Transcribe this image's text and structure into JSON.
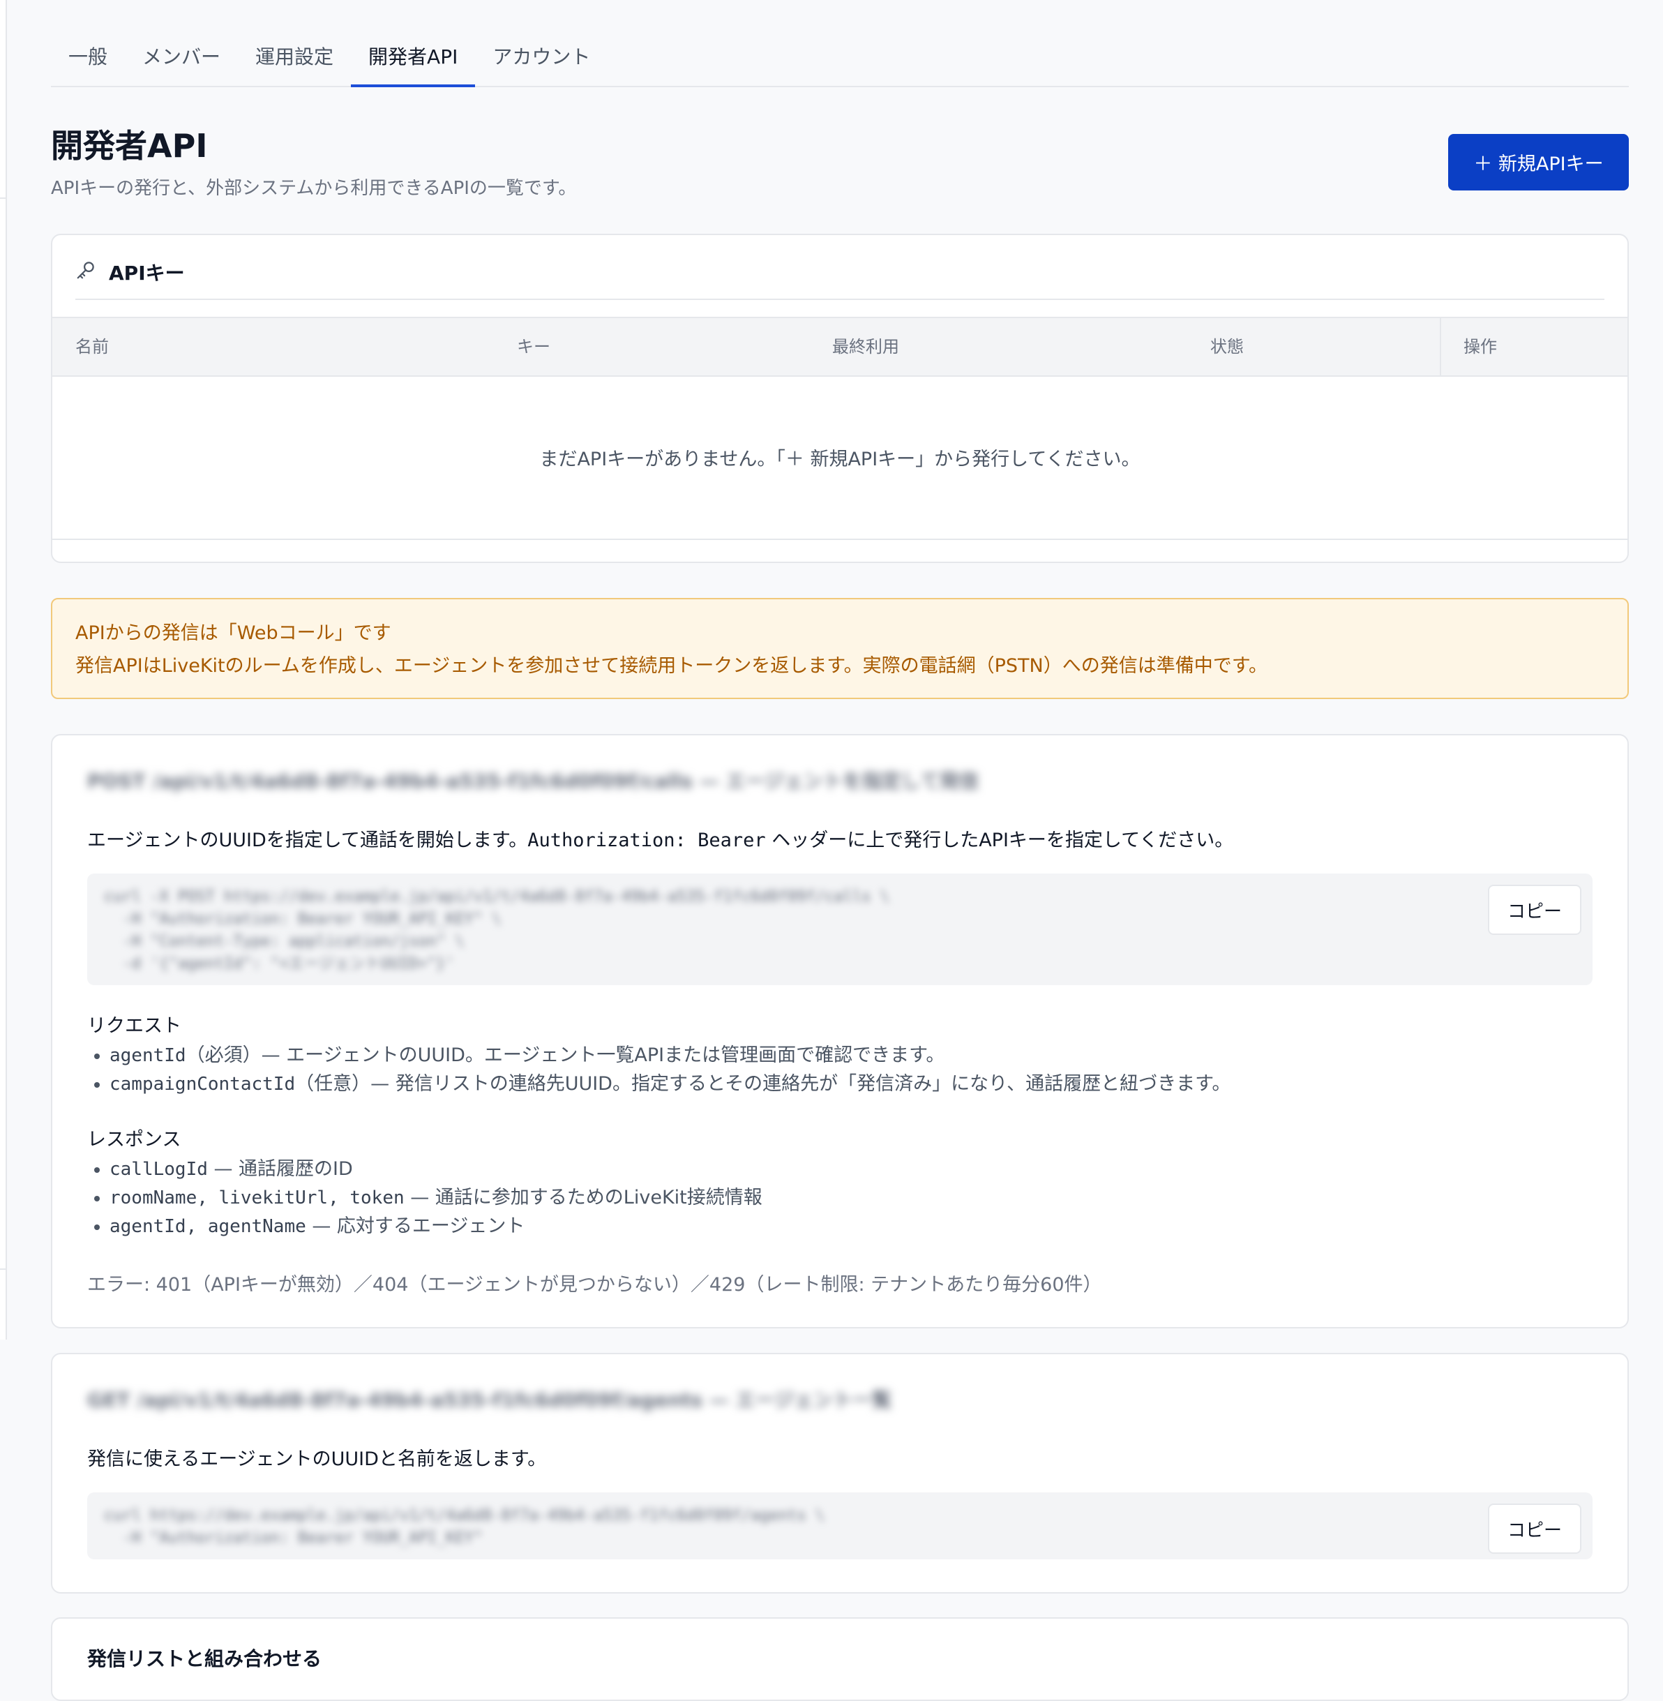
{
  "tabs": [
    "一般",
    "メンバー",
    "運用設定",
    "開発者API",
    "アカウント"
  ],
  "header": {
    "title": "開発者API",
    "subtitle": "APIキーの発行と、外部システムから利用できるAPIの一覧です。",
    "new_key_label": "＋ 新規APIキー"
  },
  "api_keys": {
    "title": "APIキー",
    "columns": {
      "name": "名前",
      "key": "キー",
      "last_used": "最終利用",
      "status": "状態",
      "actions": "操作"
    },
    "empty": "まだAPIキーがありません。「＋ 新規APIキー」から発行してください。"
  },
  "notice": {
    "title": "APIからの発信は「Webコール」です",
    "body": "発信APIはLiveKitのルームを作成し、エージェントを参加させて接続用トークンを返します。実際の電話網（PSTN）への発信は準備中です。"
  },
  "endpoint_call": {
    "title": "POST /api/v1/t/4a6d8-8f7a-49b4-a535-f1fc6d0f09f/calls — エージェントを指定して発信",
    "desc_before": "エージェントのUUIDを指定して通話を開始します。",
    "desc_code": "Authorization: Bearer",
    "desc_after": "ヘッダーに上で発行したAPIキーを指定してください。",
    "code": "curl -X POST https://dev.example.jp/api/v1/t/4a6d8-8f7a-49b4-a535-f1fc6d0f09f/calls \\\n  -H \"Authorization: Bearer YOUR_API_KEY\" \\\n  -H \"Content-Type: application/json\" \\\n  -d '{\"agentId\": \"<エージェントUUID>\"}'",
    "copy_label": "コピー",
    "request_label": "リクエスト",
    "request_items": [
      {
        "key": "agentId",
        "text": "（必須）— エージェントのUUID。エージェント一覧APIまたは管理画面で確認できます。"
      },
      {
        "key": "campaignContactId",
        "text": "（任意）— 発信リストの連絡先UUID。指定するとその連絡先が「発信済み」になり、通話履歴と紐づきます。"
      }
    ],
    "response_label": "レスポンス",
    "response_items": [
      {
        "key": "callLogId",
        "text": " — 通話履歴のID"
      },
      {
        "key": "roomName, livekitUrl, token",
        "text": " — 通話に参加するためのLiveKit接続情報"
      },
      {
        "key": "agentId, agentName",
        "text": " — 応対するエージェント"
      }
    ],
    "errors": "エラー: 401（APIキーが無効）／404（エージェントが見つからない）／429（レート制限: テナントあたり毎分60件）"
  },
  "endpoint_agents": {
    "title": "GET /api/v1/t/4a6d8-8f7a-49b4-a535-f1fc6d0f09f/agents — エージェント一覧",
    "desc": "発信に使えるエージェントのUUIDと名前を返します。",
    "code": "curl https://dev.example.jp/api/v1/t/4a6d8-8f7a-49b4-a535-f1fc6d0f09f/agents \\\n  -H \"Authorization: Bearer YOUR_API_KEY\"",
    "copy_label": "コピー"
  },
  "campaign_section": {
    "title": "発信リストと組み合わせる"
  },
  "colors": {
    "accent": "#0b3fc5",
    "notice_bg": "#fef6e6",
    "notice_text": "#a75a00"
  }
}
